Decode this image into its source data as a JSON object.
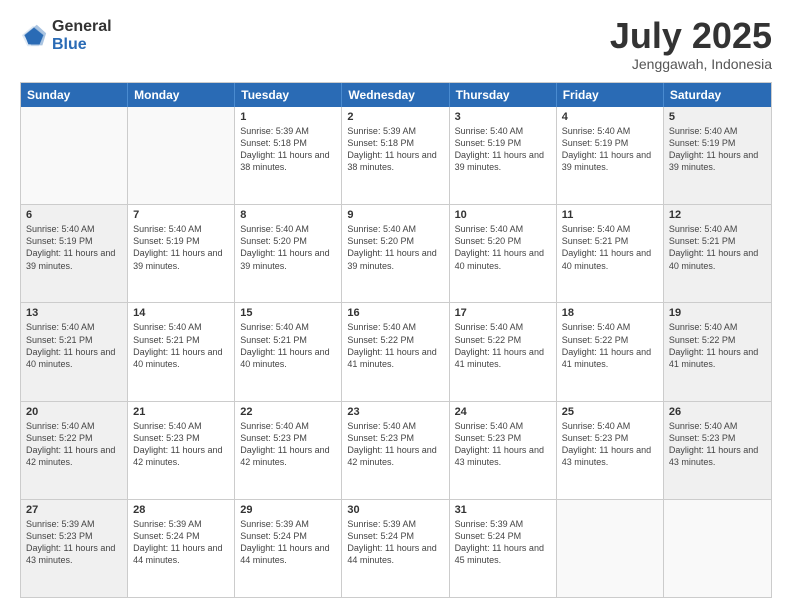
{
  "logo": {
    "general": "General",
    "blue": "Blue"
  },
  "title": {
    "month_year": "July 2025",
    "location": "Jenggawah, Indonesia"
  },
  "days_of_week": [
    "Sunday",
    "Monday",
    "Tuesday",
    "Wednesday",
    "Thursday",
    "Friday",
    "Saturday"
  ],
  "weeks": [
    [
      {
        "day": "",
        "content": ""
      },
      {
        "day": "",
        "content": ""
      },
      {
        "day": "1",
        "content": "Sunrise: 5:39 AM\nSunset: 5:18 PM\nDaylight: 11 hours and 38 minutes."
      },
      {
        "day": "2",
        "content": "Sunrise: 5:39 AM\nSunset: 5:18 PM\nDaylight: 11 hours and 38 minutes."
      },
      {
        "day": "3",
        "content": "Sunrise: 5:40 AM\nSunset: 5:19 PM\nDaylight: 11 hours and 39 minutes."
      },
      {
        "day": "4",
        "content": "Sunrise: 5:40 AM\nSunset: 5:19 PM\nDaylight: 11 hours and 39 minutes."
      },
      {
        "day": "5",
        "content": "Sunrise: 5:40 AM\nSunset: 5:19 PM\nDaylight: 11 hours and 39 minutes."
      }
    ],
    [
      {
        "day": "6",
        "content": "Sunrise: 5:40 AM\nSunset: 5:19 PM\nDaylight: 11 hours and 39 minutes."
      },
      {
        "day": "7",
        "content": "Sunrise: 5:40 AM\nSunset: 5:19 PM\nDaylight: 11 hours and 39 minutes."
      },
      {
        "day": "8",
        "content": "Sunrise: 5:40 AM\nSunset: 5:20 PM\nDaylight: 11 hours and 39 minutes."
      },
      {
        "day": "9",
        "content": "Sunrise: 5:40 AM\nSunset: 5:20 PM\nDaylight: 11 hours and 39 minutes."
      },
      {
        "day": "10",
        "content": "Sunrise: 5:40 AM\nSunset: 5:20 PM\nDaylight: 11 hours and 40 minutes."
      },
      {
        "day": "11",
        "content": "Sunrise: 5:40 AM\nSunset: 5:21 PM\nDaylight: 11 hours and 40 minutes."
      },
      {
        "day": "12",
        "content": "Sunrise: 5:40 AM\nSunset: 5:21 PM\nDaylight: 11 hours and 40 minutes."
      }
    ],
    [
      {
        "day": "13",
        "content": "Sunrise: 5:40 AM\nSunset: 5:21 PM\nDaylight: 11 hours and 40 minutes."
      },
      {
        "day": "14",
        "content": "Sunrise: 5:40 AM\nSunset: 5:21 PM\nDaylight: 11 hours and 40 minutes."
      },
      {
        "day": "15",
        "content": "Sunrise: 5:40 AM\nSunset: 5:21 PM\nDaylight: 11 hours and 40 minutes."
      },
      {
        "day": "16",
        "content": "Sunrise: 5:40 AM\nSunset: 5:22 PM\nDaylight: 11 hours and 41 minutes."
      },
      {
        "day": "17",
        "content": "Sunrise: 5:40 AM\nSunset: 5:22 PM\nDaylight: 11 hours and 41 minutes."
      },
      {
        "day": "18",
        "content": "Sunrise: 5:40 AM\nSunset: 5:22 PM\nDaylight: 11 hours and 41 minutes."
      },
      {
        "day": "19",
        "content": "Sunrise: 5:40 AM\nSunset: 5:22 PM\nDaylight: 11 hours and 41 minutes."
      }
    ],
    [
      {
        "day": "20",
        "content": "Sunrise: 5:40 AM\nSunset: 5:22 PM\nDaylight: 11 hours and 42 minutes."
      },
      {
        "day": "21",
        "content": "Sunrise: 5:40 AM\nSunset: 5:23 PM\nDaylight: 11 hours and 42 minutes."
      },
      {
        "day": "22",
        "content": "Sunrise: 5:40 AM\nSunset: 5:23 PM\nDaylight: 11 hours and 42 minutes."
      },
      {
        "day": "23",
        "content": "Sunrise: 5:40 AM\nSunset: 5:23 PM\nDaylight: 11 hours and 42 minutes."
      },
      {
        "day": "24",
        "content": "Sunrise: 5:40 AM\nSunset: 5:23 PM\nDaylight: 11 hours and 43 minutes."
      },
      {
        "day": "25",
        "content": "Sunrise: 5:40 AM\nSunset: 5:23 PM\nDaylight: 11 hours and 43 minutes."
      },
      {
        "day": "26",
        "content": "Sunrise: 5:40 AM\nSunset: 5:23 PM\nDaylight: 11 hours and 43 minutes."
      }
    ],
    [
      {
        "day": "27",
        "content": "Sunrise: 5:39 AM\nSunset: 5:23 PM\nDaylight: 11 hours and 43 minutes."
      },
      {
        "day": "28",
        "content": "Sunrise: 5:39 AM\nSunset: 5:24 PM\nDaylight: 11 hours and 44 minutes."
      },
      {
        "day": "29",
        "content": "Sunrise: 5:39 AM\nSunset: 5:24 PM\nDaylight: 11 hours and 44 minutes."
      },
      {
        "day": "30",
        "content": "Sunrise: 5:39 AM\nSunset: 5:24 PM\nDaylight: 11 hours and 44 minutes."
      },
      {
        "day": "31",
        "content": "Sunrise: 5:39 AM\nSunset: 5:24 PM\nDaylight: 11 hours and 45 minutes."
      },
      {
        "day": "",
        "content": ""
      },
      {
        "day": "",
        "content": ""
      }
    ]
  ]
}
